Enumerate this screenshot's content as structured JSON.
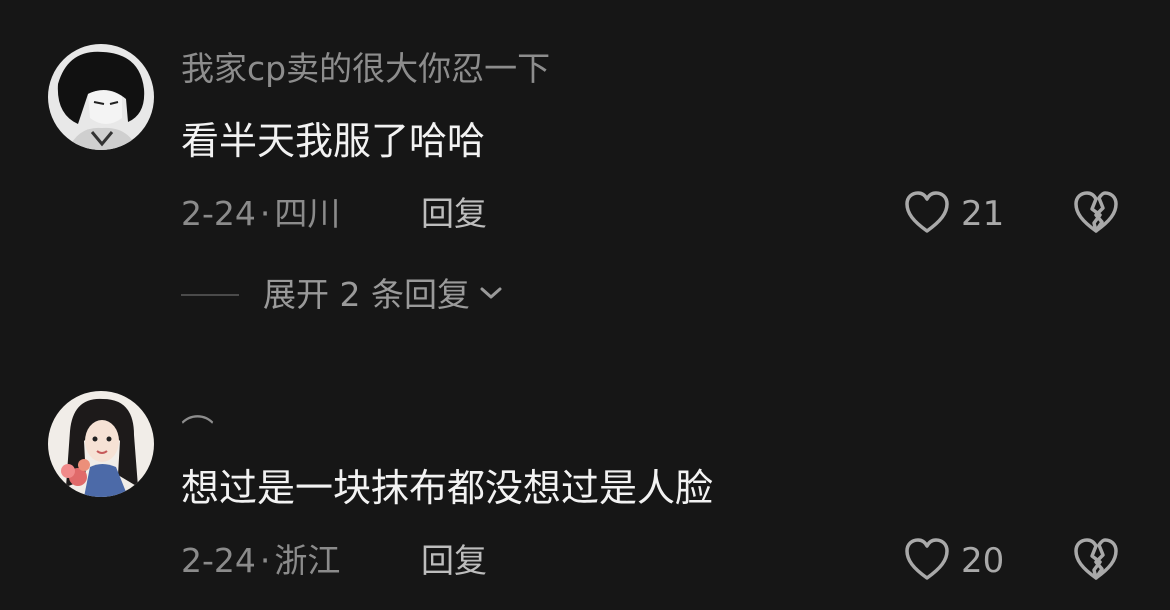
{
  "comments": [
    {
      "username": "我家cp卖的很大你忍一下",
      "text": "看半天我服了哈哈",
      "date": "2-24",
      "location": "四川",
      "reply_label": "回复",
      "likes": "21",
      "expand_label": "展开 2 条回复"
    },
    {
      "username": "︵",
      "text": "想过是一块抹布都没想过是人脸",
      "date": "2-24",
      "location": "浙江",
      "reply_label": "回复",
      "likes": "20"
    }
  ],
  "separator": "·",
  "icons": {
    "like": "heart-outline-icon",
    "dislike": "broken-heart-icon",
    "expand": "chevron-down-icon"
  },
  "colors": {
    "background": "#161616",
    "username": "#8d8d8d",
    "text": "#f2f2f2",
    "meta": "#8b8b8b"
  }
}
